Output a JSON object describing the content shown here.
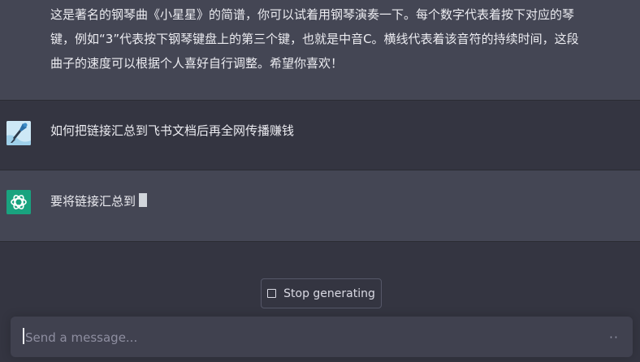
{
  "conversation": {
    "previous_assistant_text": "这是著名的钢琴曲《小星星》的简谱，你可以试着用钢琴演奏一下。每个数字代表着按下对应的琴键，例如“3”代表按下钢琴键盘上的第三个键，也就是中音C。横线代表着该音符的持续时间，这段曲子的速度可以根据个人喜好自行调整。希望你喜欢！",
    "user_message": "如何把链接汇总到飞书文档后再全网传播赚钱",
    "assistant_streaming_text": "要将链接汇总到"
  },
  "controls": {
    "stop_label": "Stop generating",
    "input_placeholder": "Send a message...",
    "input_value": "",
    "more_indicator": "··"
  },
  "colors": {
    "page_bg": "#343541",
    "assistant_bg": "#444654",
    "gpt_accent": "#19a37f",
    "composer_bg": "#40414f"
  },
  "icons": {
    "user_avatar": "user-avatar-image",
    "assistant_avatar": "openai-logo-icon",
    "stop": "stop-square-icon"
  }
}
